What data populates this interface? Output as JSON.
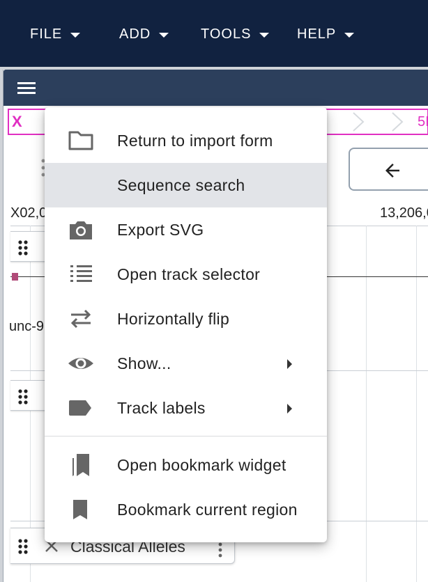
{
  "appbar": {
    "menus": [
      {
        "label": "FILE"
      },
      {
        "label": "ADD"
      },
      {
        "label": "TOOLS"
      },
      {
        "label": "HELP"
      }
    ]
  },
  "view": {
    "region_left": "X",
    "region_right": "5I",
    "ruler_left": "X02,0",
    "ruler_right": "13,206,0",
    "feature_label": "unc-9",
    "bottom_track_title": "Classical Alleles"
  },
  "context_menu": {
    "items": [
      {
        "label": "Return to import form",
        "icon": "folder-icon"
      },
      {
        "label": "Sequence search",
        "icon": "none"
      },
      {
        "label": "Export SVG",
        "icon": "camera-icon"
      },
      {
        "label": "Open track selector",
        "icon": "list-icon"
      },
      {
        "label": "Horizontally flip",
        "icon": "swap-horiz-icon"
      },
      {
        "label": "Show...",
        "icon": "eye-icon",
        "submenu": true
      },
      {
        "label": "Track labels",
        "icon": "label-icon",
        "submenu": true
      },
      {
        "label": "Open bookmark widget",
        "icon": "bookmarks-icon"
      },
      {
        "label": "Bookmark current region",
        "icon": "bookmark-icon"
      }
    ],
    "highlighted": "Sequence search"
  },
  "colors": {
    "appbar": "#112240",
    "view_header": "#2c3f5c",
    "region_accent": "#e12fc2",
    "menu_hover": "#e2e4e8",
    "icon": "#666666"
  }
}
